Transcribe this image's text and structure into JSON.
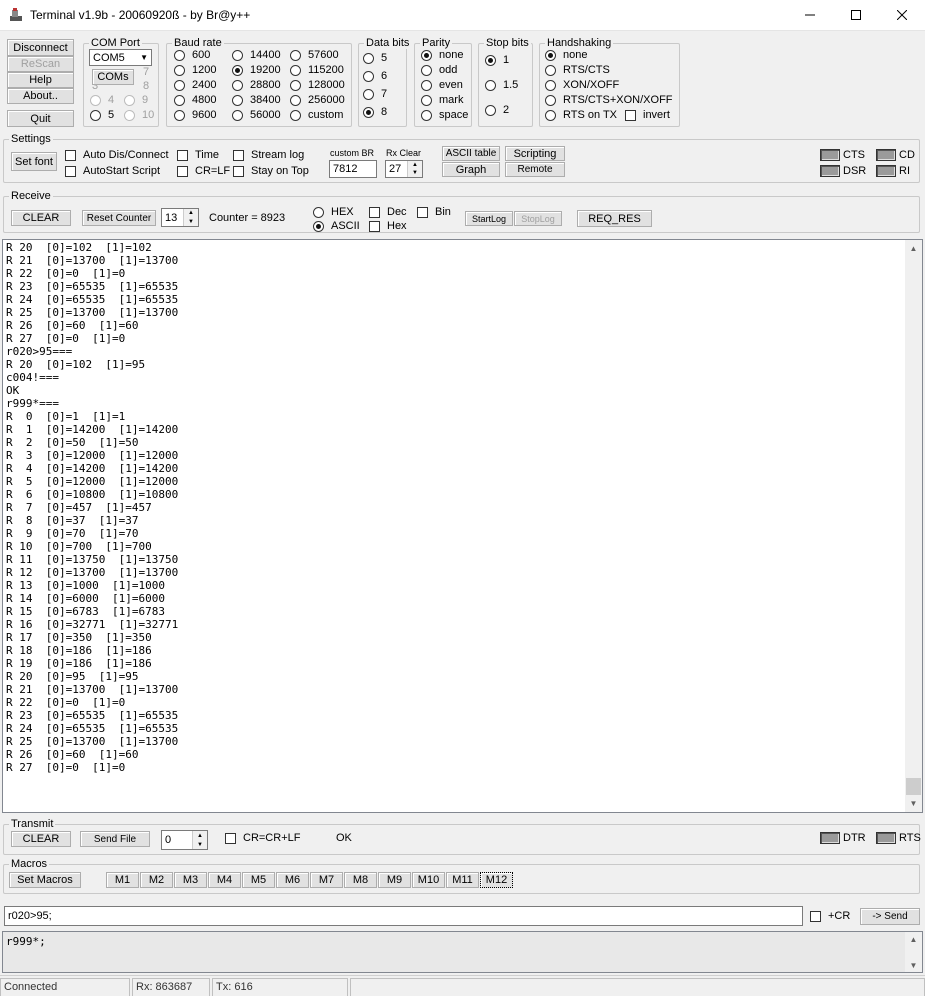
{
  "window": {
    "title": "Terminal v1.9b - 20060920ß - by Br@y++"
  },
  "left_buttons": {
    "disconnect": "Disconnect",
    "rescan": "ReScan",
    "help": "Help",
    "about": "About..",
    "quit": "Quit"
  },
  "com_port": {
    "label": "COM Port",
    "value": "COM5",
    "coms_button": "COMs",
    "ghost_numbers": [
      "1",
      "7",
      "3",
      "8"
    ],
    "options": [
      "4",
      "9",
      "5",
      "10"
    ],
    "selected": "5"
  },
  "baud": {
    "label": "Baud rate",
    "options": [
      "600",
      "14400",
      "57600",
      "1200",
      "19200",
      "115200",
      "2400",
      "28800",
      "128000",
      "4800",
      "38400",
      "256000",
      "9600",
      "56000",
      "custom"
    ],
    "selected": "19200"
  },
  "data_bits": {
    "label": "Data bits",
    "options": [
      "5",
      "6",
      "7",
      "8"
    ],
    "selected": "8"
  },
  "parity": {
    "label": "Parity",
    "options": [
      "none",
      "odd",
      "even",
      "mark",
      "space"
    ],
    "selected": "none"
  },
  "stop_bits": {
    "label": "Stop bits",
    "options": [
      "1",
      "1.5",
      "2"
    ],
    "selected": "1"
  },
  "handshaking": {
    "label": "Handshaking",
    "options": [
      "none",
      "RTS/CTS",
      "XON/XOFF",
      "RTS/CTS+XON/XOFF",
      "RTS on TX"
    ],
    "selected": "none",
    "invert": "invert"
  },
  "settings": {
    "label": "Settings",
    "set_font": "Set font",
    "auto_dis": "Auto Dis/Connect",
    "autostart": "AutoStart Script",
    "time": "Time",
    "crlf": "CR=LF",
    "stream_log": "Stream log",
    "stay_on_top": "Stay on Top",
    "custom_br_label": "custom BR",
    "custom_br_value": "7812",
    "rx_clear_label": "Rx Clear",
    "rx_clear_value": "27",
    "ascii_table": "ASCII table",
    "graph": "Graph",
    "scripting": "Scripting",
    "remote": "Remote",
    "leds": [
      "CTS",
      "CD",
      "DSR",
      "RI"
    ]
  },
  "receive": {
    "label": "Receive",
    "clear": "CLEAR",
    "reset_counter": "Reset Counter",
    "counter_spin": "13",
    "counter_label": "Counter = ",
    "counter_value": "8923",
    "hex": "HEX",
    "ascii": "ASCII",
    "dec": "Dec",
    "hex2": "Hex",
    "bin": "Bin",
    "startlog": "StartLog",
    "stoplog": "StopLog",
    "req_res": "REQ_RES"
  },
  "terminal_lines": [
    "R 20  [0]=102  [1]=102",
    "R 21  [0]=13700  [1]=13700",
    "R 22  [0]=0  [1]=0",
    "R 23  [0]=65535  [1]=65535",
    "R 24  [0]=65535  [1]=65535",
    "R 25  [0]=13700  [1]=13700",
    "R 26  [0]=60  [1]=60",
    "R 27  [0]=0  [1]=0",
    "r020>95===",
    "R 20  [0]=102  [1]=95",
    "c004!===",
    "OK",
    "r999*===",
    "R  0  [0]=1  [1]=1",
    "R  1  [0]=14200  [1]=14200",
    "R  2  [0]=50  [1]=50",
    "R  3  [0]=12000  [1]=12000",
    "R  4  [0]=14200  [1]=14200",
    "R  5  [0]=12000  [1]=12000",
    "R  6  [0]=10800  [1]=10800",
    "R  7  [0]=457  [1]=457",
    "R  8  [0]=37  [1]=37",
    "R  9  [0]=70  [1]=70",
    "R 10  [0]=700  [1]=700",
    "R 11  [0]=13750  [1]=13750",
    "R 12  [0]=13700  [1]=13700",
    "R 13  [0]=1000  [1]=1000",
    "R 14  [0]=6000  [1]=6000",
    "R 15  [0]=6783  [1]=6783",
    "R 16  [0]=32771  [1]=32771",
    "R 17  [0]=350  [1]=350",
    "R 18  [0]=186  [1]=186",
    "R 19  [0]=186  [1]=186",
    "R 20  [0]=95  [1]=95",
    "R 21  [0]=13700  [1]=13700",
    "R 22  [0]=0  [1]=0",
    "R 23  [0]=65535  [1]=65535",
    "R 24  [0]=65535  [1]=65535",
    "R 25  [0]=13700  [1]=13700",
    "R 26  [0]=60  [1]=60",
    "R 27  [0]=0  [1]=0"
  ],
  "transmit": {
    "label": "Transmit",
    "clear": "CLEAR",
    "send_file": "Send File",
    "spin": "0",
    "crcrlf": "CR=CR+LF",
    "status": "OK",
    "leds": [
      "DTR",
      "RTS"
    ]
  },
  "macros": {
    "label": "Macros",
    "set_macros": "Set Macros",
    "items": [
      "M1",
      "M2",
      "M3",
      "M4",
      "M5",
      "M6",
      "M7",
      "M8",
      "M9",
      "M10",
      "M11",
      "M12"
    ]
  },
  "send": {
    "input": "r020>95;",
    "plus_cr": "+CR",
    "send_button": "-> Send"
  },
  "tx_history": "r999*;",
  "statusbar": {
    "connection": "Connected",
    "rx": "Rx: 863687",
    "tx": "Tx: 616"
  }
}
